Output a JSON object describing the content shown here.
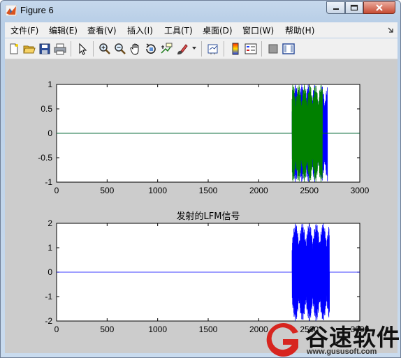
{
  "window": {
    "title": "Figure 6"
  },
  "menu": [
    {
      "id": "file",
      "label": "文件(F)"
    },
    {
      "id": "edit",
      "label": "编辑(E)"
    },
    {
      "id": "view",
      "label": "查看(V)"
    },
    {
      "id": "insert",
      "label": "插入(I)"
    },
    {
      "id": "tools",
      "label": "工具(T)"
    },
    {
      "id": "desktop",
      "label": "桌面(D)"
    },
    {
      "id": "window",
      "label": "窗口(W)"
    },
    {
      "id": "help",
      "label": "帮助(H)"
    }
  ],
  "toolbar": [
    "new-figure-icon",
    "open-file-icon",
    "save-icon",
    "print-icon",
    "pointer-icon",
    "zoom-in-icon",
    "zoom-out-icon",
    "pan-icon",
    "rotate-3d-icon",
    "data-cursor-icon",
    "brush-icon",
    "link-icon",
    "colorbar-icon",
    "legend-icon",
    "hide-plot-tools-icon",
    "show-plot-tools-icon"
  ],
  "chart_data": [
    {
      "type": "line",
      "title": "",
      "xlim": [
        0,
        3000
      ],
      "ylim": [
        -1,
        1
      ],
      "xticks": [
        0,
        500,
        1000,
        1500,
        2000,
        2500,
        3000
      ],
      "yticks": [
        -1,
        -0.5,
        0,
        0.5,
        1
      ],
      "yticklabels": [
        "-1",
        "-0.5",
        "0",
        "0.5",
        "1"
      ],
      "series": [
        {
          "color": "#0000ff",
          "x_start": 2330,
          "x_end": 2680,
          "amplitude": 1.0,
          "baseline": 0
        },
        {
          "color": "#008000",
          "x_start": 2330,
          "x_end": 2630,
          "amplitude": 1.0,
          "baseline": 0
        }
      ]
    },
    {
      "type": "line",
      "title": "发射的LFM信号",
      "xlim": [
        0,
        3000
      ],
      "ylim": [
        -2,
        2
      ],
      "xticks": [
        0,
        500,
        1000,
        1500,
        2000,
        2500,
        3000
      ],
      "yticks": [
        -2,
        -1,
        0,
        1,
        2
      ],
      "yticklabels": [
        "-2",
        "-1",
        "0",
        "1",
        "2"
      ],
      "series": [
        {
          "color": "#0000ff",
          "x_start": 2330,
          "x_end": 2700,
          "amplitude": 2.0,
          "baseline": 0
        }
      ]
    }
  ],
  "watermark": {
    "brand": "谷速软件",
    "url": "www.gususoft.com"
  },
  "colors": {
    "axes_bg": "#ffffff",
    "figure_bg": "#cccccc",
    "title_bar": "#b9cfe7"
  }
}
